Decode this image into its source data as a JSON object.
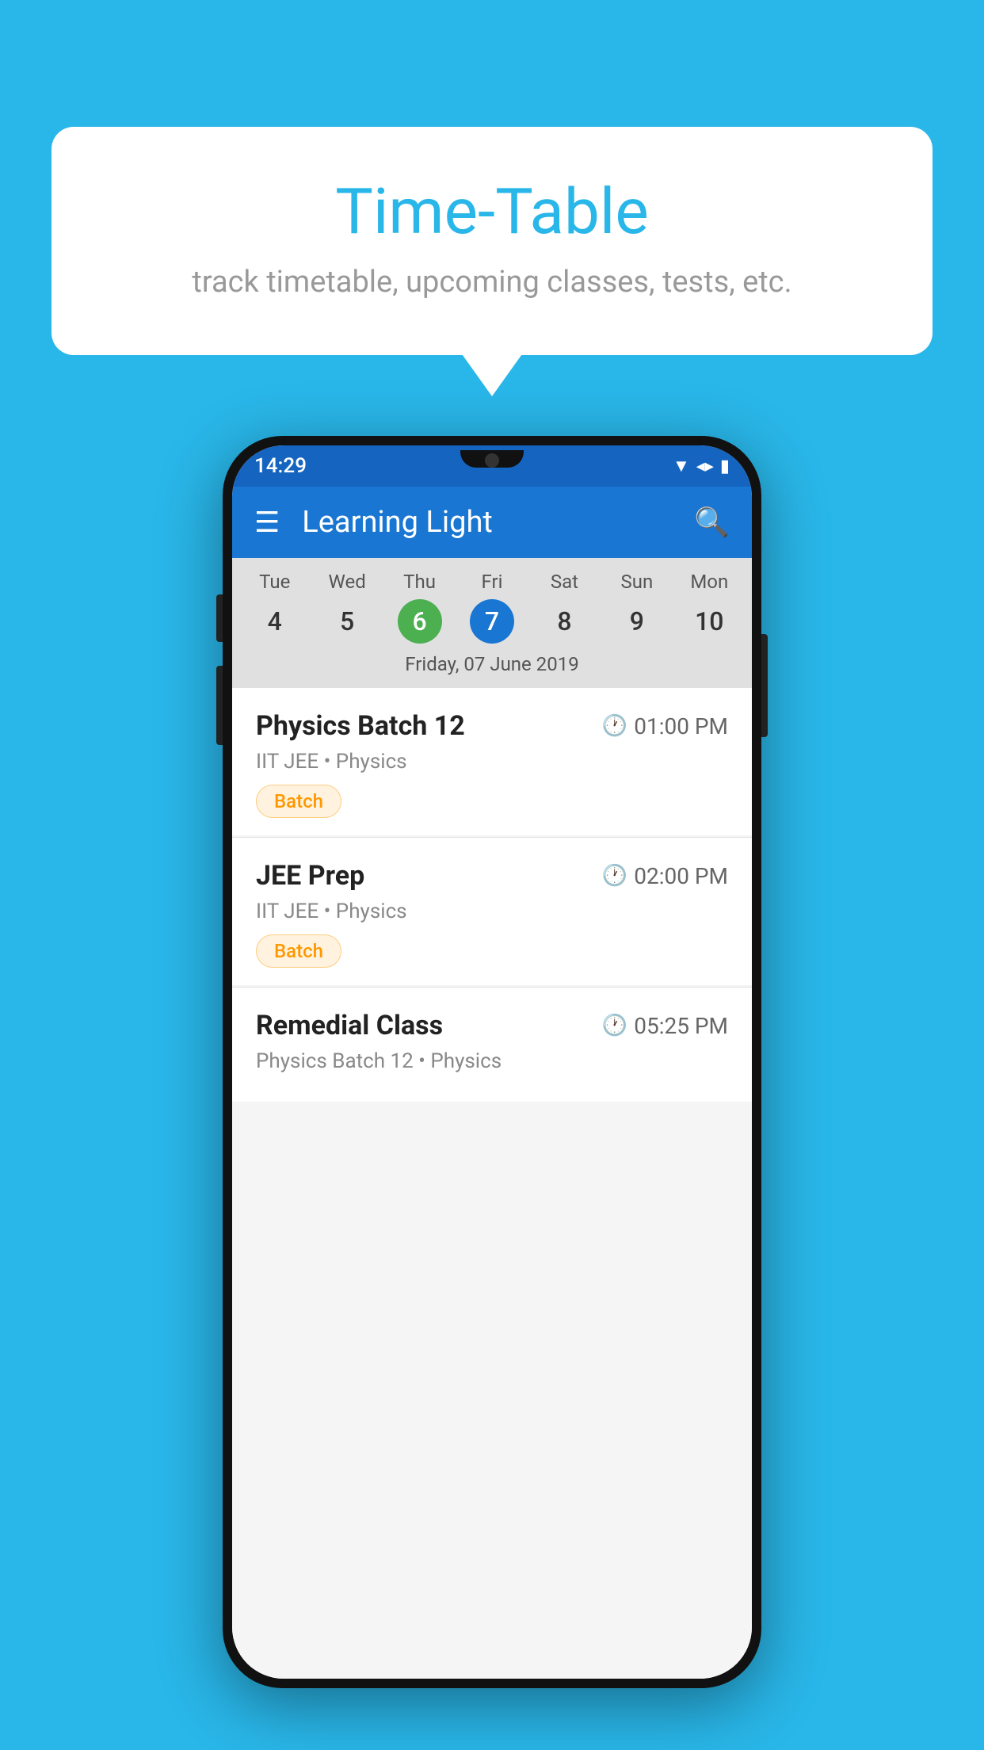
{
  "background_color": "#29B6E8",
  "card": {
    "title": "Time-Table",
    "subtitle": "track timetable, upcoming classes, tests, etc."
  },
  "status_bar": {
    "time": "14:29"
  },
  "app_bar": {
    "title": "Learning Light"
  },
  "calendar": {
    "days": [
      {
        "name": "Tue",
        "num": "4",
        "state": "normal"
      },
      {
        "name": "Wed",
        "num": "5",
        "state": "normal"
      },
      {
        "name": "Thu",
        "num": "6",
        "state": "today"
      },
      {
        "name": "Fri",
        "num": "7",
        "state": "selected"
      },
      {
        "name": "Sat",
        "num": "8",
        "state": "normal"
      },
      {
        "name": "Sun",
        "num": "9",
        "state": "normal"
      },
      {
        "name": "Mon",
        "num": "10",
        "state": "normal"
      }
    ],
    "selected_date_label": "Friday, 07 June 2019"
  },
  "schedule": [
    {
      "title": "Physics Batch 12",
      "time": "01:00 PM",
      "subtitle": "IIT JEE • Physics",
      "tag": "Batch"
    },
    {
      "title": "JEE Prep",
      "time": "02:00 PM",
      "subtitle": "IIT JEE • Physics",
      "tag": "Batch"
    },
    {
      "title": "Remedial Class",
      "time": "05:25 PM",
      "subtitle": "Physics Batch 12 • Physics",
      "tag": ""
    }
  ]
}
